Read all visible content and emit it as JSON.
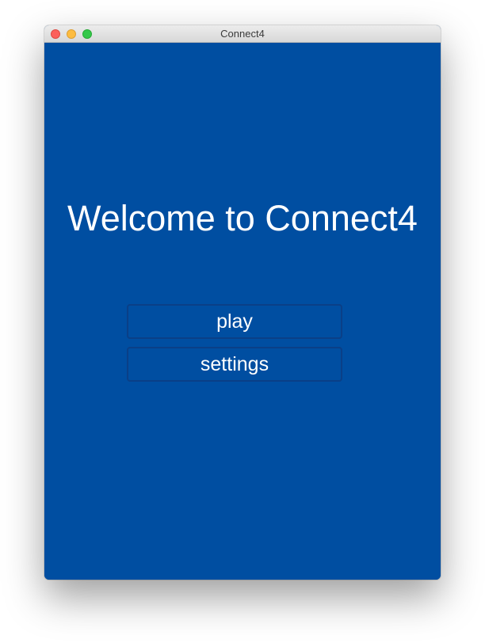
{
  "window": {
    "title": "Connect4",
    "controls": [
      "close-icon",
      "minimize-icon",
      "maximize-icon"
    ]
  },
  "main": {
    "headline": "Welcome to Connect4",
    "buttons": {
      "play_label": "play",
      "settings_label": "settings"
    }
  },
  "colors": {
    "background": "#004ea1",
    "button_border": "#0a3f87",
    "text": "#ffffff"
  }
}
